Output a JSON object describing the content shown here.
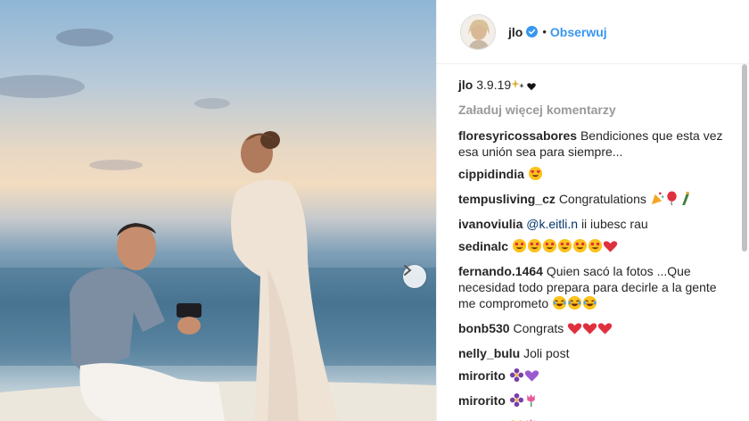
{
  "post": {
    "username": "jlo",
    "follow_label": "Obserwuj",
    "dot": "•"
  },
  "caption": {
    "username": "jlo",
    "text": "3.9.19",
    "emojis": [
      "sparkle-icon",
      "heart-icon"
    ]
  },
  "load_more_label": "Załaduj więcej komentarzy",
  "comments": [
    {
      "username": "floresyricossabores",
      "text": "Bendiciones que esta vez esa unión sea para siempre..."
    },
    {
      "username": "cippidindia",
      "text": "",
      "emojis": [
        "heart-eyes-emoji"
      ]
    },
    {
      "username": "tempusliving_cz",
      "text": "Congratulations",
      "emojis": [
        "party-popper-emoji",
        "balloon-emoji",
        "champagne-emoji"
      ]
    },
    {
      "username": "ivanoviulia",
      "mention": "@k.eitli.n",
      "text": "ii iubesc rau"
    },
    {
      "username": "sedinalc",
      "text": "",
      "emojis": [
        "heart-eyes-emoji",
        "heart-eyes-emoji",
        "heart-eyes-emoji",
        "heart-eyes-emoji",
        "heart-eyes-emoji",
        "heart-eyes-emoji",
        "red-heart-emoji"
      ]
    },
    {
      "username": "fernando.1464",
      "text": "Quien sacó la fotos ...Que necesidad todo prepara para decirle a la gente me comprometo",
      "emojis": [
        "laughing-emoji",
        "laughing-emoji",
        "laughing-emoji"
      ]
    },
    {
      "username": "bonb530",
      "text": "Congrats",
      "emojis": [
        "red-heart-emoji",
        "red-heart-emoji",
        "red-heart-emoji"
      ]
    },
    {
      "username": "nelly_bulu",
      "text": "Joli post"
    },
    {
      "username": "mirorito",
      "text": "",
      "emojis": [
        "purple-flower-emoji",
        "purple-heart-emoji"
      ]
    },
    {
      "username": "mirorito",
      "text": "",
      "emojis": [
        "purple-flower-emoji",
        "tulip-emoji"
      ]
    },
    {
      "username": "mirorito",
      "text": "",
      "emojis": [
        "yellow-heart-emoji",
        "tulip-emoji"
      ]
    }
  ],
  "colors": {
    "link_blue": "#3897f0",
    "verified_blue": "#3897f0",
    "muted": "#999999",
    "text": "#262626"
  }
}
